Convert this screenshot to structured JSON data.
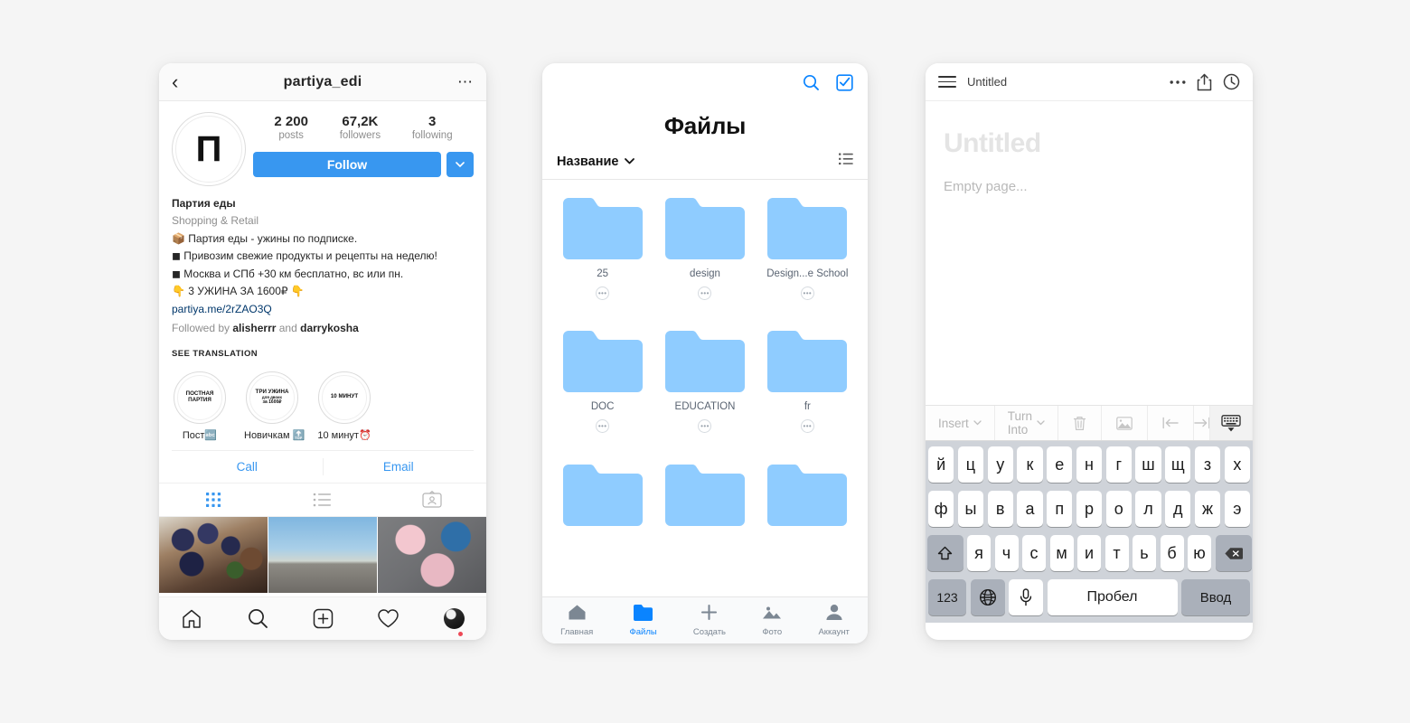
{
  "instagram": {
    "navbar": {
      "title": "partiya_edi",
      "back_icon": "chevron-left-icon",
      "more_icon": "ellipsis-icon"
    },
    "stats": [
      {
        "value": "2 200",
        "label": "posts"
      },
      {
        "value": "67,2K",
        "label": "followers"
      },
      {
        "value": "3",
        "label": "following"
      }
    ],
    "avatar_letter": "П",
    "follow_label": "Follow",
    "bio": {
      "name": "Партия еды",
      "category": "Shopping & Retail",
      "lines": [
        "📦 Партия еды - ужины по подписке.",
        "◼ Привозим свежие продукты и рецепты на неделю!",
        "◼ Москва и СПб +30 км бесплатно, вс или пн.",
        "👇 3 УЖИНА ЗА 1600₽ 👇"
      ],
      "link": "partiya.me/2rZAO3Q",
      "followed_prefix": "Followed by ",
      "followed_user1": "alisherrr",
      "followed_mid": " and ",
      "followed_user2": "darrykosha",
      "see_translation": "SEE TRANSLATION"
    },
    "highlights": [
      {
        "cover_line1": "ПОСТНАЯ",
        "cover_line2": "ПАРТИЯ",
        "cover_line3": "",
        "label": "Пост🔤"
      },
      {
        "cover_line1": "ТРИ УЖИНА",
        "cover_line2": "для двоих",
        "cover_line3": "за 1600₽",
        "label": "Новичкам 🔝"
      },
      {
        "cover_line1": "10 МИНУТ",
        "cover_line2": "",
        "cover_line3": "",
        "label": "10 минут⏰"
      }
    ],
    "contact": {
      "call": "Call",
      "email": "Email"
    },
    "tabs": [
      {
        "name": "grid-tab",
        "icon": "grid-icon",
        "active": true
      },
      {
        "name": "list-tab",
        "icon": "list-icon",
        "active": false
      },
      {
        "name": "tagged-tab",
        "icon": "tagged-person-icon",
        "active": false
      }
    ],
    "tabbar": [
      "home-icon",
      "search-icon",
      "add-post-icon",
      "heart-icon",
      "profile-avatar-icon"
    ]
  },
  "files": {
    "header": {
      "title": "Файлы",
      "search_icon": "search-icon",
      "select_icon": "checkbox-select-icon"
    },
    "sort": {
      "label": "Название",
      "chevron": "chevron-down-icon",
      "view_icon": "list-view-icon"
    },
    "folders": [
      {
        "name": "25"
      },
      {
        "name": "design"
      },
      {
        "name": "Design...e School"
      },
      {
        "name": "DOC"
      },
      {
        "name": "EDUCATION"
      },
      {
        "name": "fr"
      },
      {
        "name": ""
      },
      {
        "name": ""
      },
      {
        "name": ""
      }
    ],
    "folder_menu_glyph": "•••",
    "tabbar": [
      {
        "label": "Главная",
        "icon": "home-icon",
        "active": false
      },
      {
        "label": "Файлы",
        "icon": "folder-icon",
        "active": true
      },
      {
        "label": "Создать",
        "icon": "plus-icon",
        "active": false
      },
      {
        "label": "Фото",
        "icon": "photo-icon",
        "active": false
      },
      {
        "label": "Аккаунт",
        "icon": "account-icon",
        "active": false
      }
    ],
    "folder_color": "#8FCCFF",
    "accent_color": "#0a84ff"
  },
  "notes": {
    "navbar": {
      "menu_icon": "hamburger-menu-icon",
      "doc_title": "Untitled",
      "more_icon": "ellipsis-icon",
      "share_icon": "share-icon",
      "history_icon": "clock-history-icon"
    },
    "page": {
      "heading_placeholder": "Untitled",
      "body_placeholder": "Empty page..."
    },
    "toolbar": [
      {
        "label": "Insert",
        "chevron": "⌄",
        "type": "dropdown",
        "name": "insert-dropdown"
      },
      {
        "label": "Turn Into",
        "chevron": "⌄",
        "type": "dropdown",
        "name": "turn-into-dropdown"
      },
      {
        "label": "",
        "type": "icon",
        "name": "delete-block-icon"
      },
      {
        "label": "",
        "type": "icon",
        "name": "insert-image-icon"
      },
      {
        "label": "",
        "type": "icon",
        "name": "outdent-icon"
      },
      {
        "label": "",
        "type": "icon",
        "name": "indent-icon"
      },
      {
        "label": "",
        "type": "icon",
        "name": "dismiss-keyboard-icon"
      }
    ],
    "keyboard": {
      "row1": [
        "й",
        "ц",
        "у",
        "к",
        "е",
        "н",
        "г",
        "ш",
        "щ",
        "з",
        "х"
      ],
      "row2": [
        "ф",
        "ы",
        "в",
        "а",
        "п",
        "р",
        "о",
        "л",
        "д",
        "ж",
        "э"
      ],
      "row3": [
        "я",
        "ч",
        "с",
        "м",
        "и",
        "т",
        "ь",
        "б",
        "ю"
      ],
      "shift_icon": "shift-icon",
      "backspace_icon": "backspace-icon",
      "numbers_label": "123",
      "globe_icon": "globe-icon",
      "mic_icon": "microphone-icon",
      "space_label": "Пробел",
      "enter_label": "Ввод"
    }
  }
}
